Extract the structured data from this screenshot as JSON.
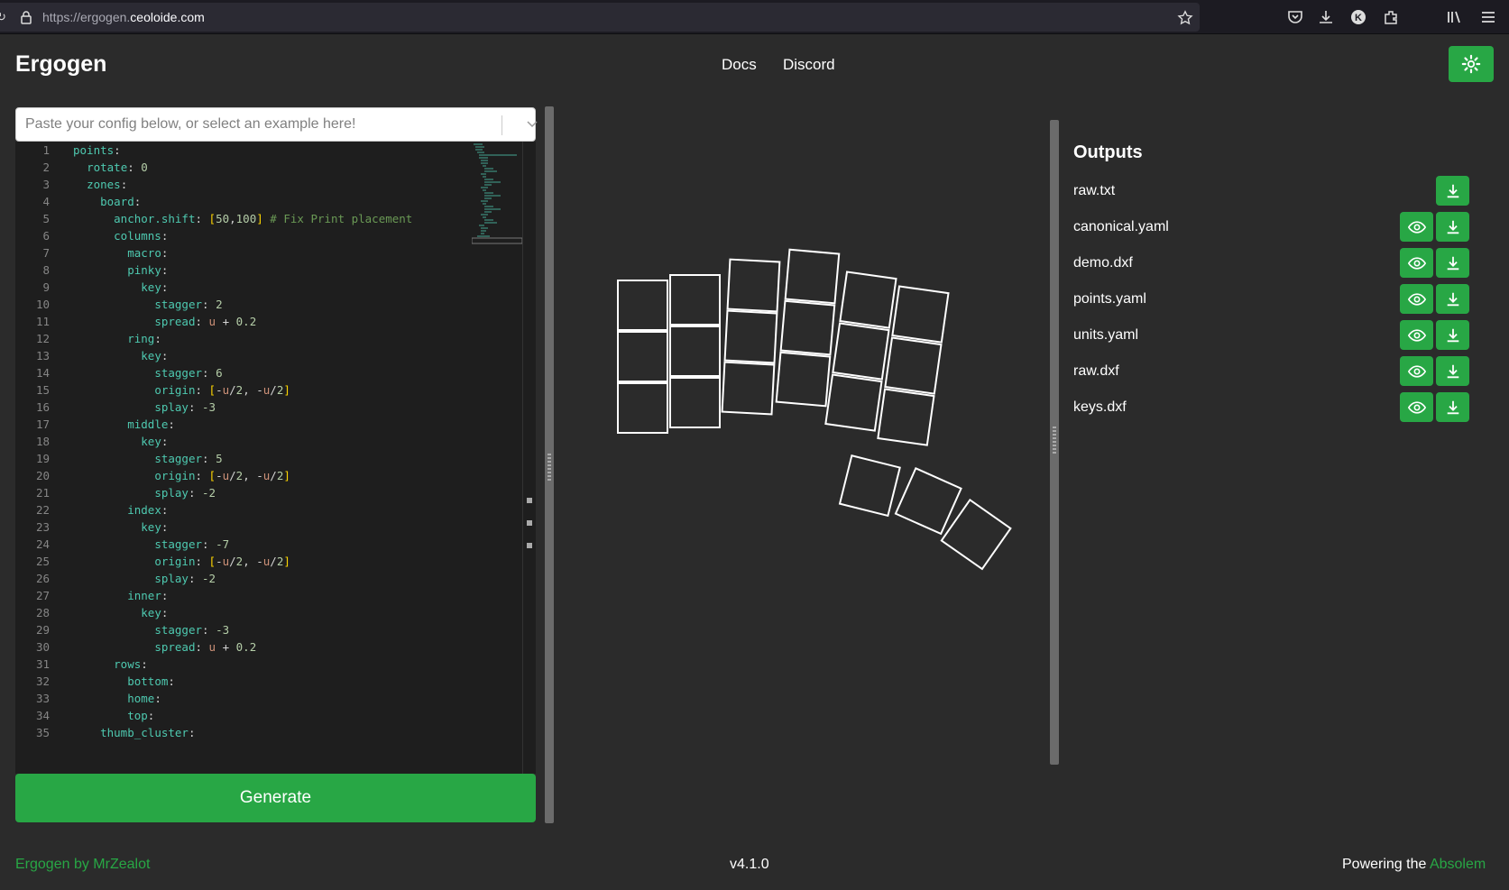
{
  "browser": {
    "url_prefix": "https://ergogen.",
    "url_domain": "ceoloide.com"
  },
  "header": {
    "brand": "Ergogen",
    "nav": [
      "Docs",
      "Discord"
    ]
  },
  "config_select": {
    "placeholder": "Paste your config below, or select an example here!"
  },
  "editor": {
    "line_numbers": [
      "1",
      "2",
      "3",
      "4",
      "5",
      "6",
      "7",
      "8",
      "9",
      "10",
      "11",
      "12",
      "13",
      "14",
      "15",
      "16",
      "17",
      "18",
      "19",
      "20",
      "21",
      "22",
      "23",
      "24",
      "25",
      "26",
      "27",
      "28",
      "29",
      "30",
      "31",
      "32",
      "33",
      "34",
      "35"
    ],
    "lines": [
      "points:",
      "  rotate: 0",
      "  zones:",
      "    board:",
      "      anchor.shift: [50,100] # Fix Print placement",
      "      columns:",
      "        macro:",
      "        pinky:",
      "          key:",
      "            stagger: 2",
      "            spread: u + 0.2",
      "        ring:",
      "          key:",
      "            stagger: 6",
      "            origin: [-u/2, -u/2]",
      "            splay: -3",
      "        middle:",
      "          key:",
      "            stagger: 5",
      "            origin: [-u/2, -u/2]",
      "            splay: -2",
      "        index:",
      "          key:",
      "            stagger: -7",
      "            origin: [-u/2, -u/2]",
      "            splay: -2",
      "        inner:",
      "          key:",
      "            stagger: -3",
      "            spread: u + 0.2",
      "      rows:",
      "        bottom:",
      "        home:",
      "        top:",
      "    thumb_cluster:"
    ]
  },
  "generate_label": "Generate",
  "outputs": {
    "title": "Outputs",
    "files": [
      {
        "name": "raw.txt",
        "preview": false
      },
      {
        "name": "canonical.yaml",
        "preview": true
      },
      {
        "name": "demo.dxf",
        "preview": true
      },
      {
        "name": "points.yaml",
        "preview": true
      },
      {
        "name": "units.yaml",
        "preview": true
      },
      {
        "name": "raw.dxf",
        "preview": true
      },
      {
        "name": "keys.dxf",
        "preview": true
      }
    ]
  },
  "footer": {
    "left_link": "Ergogen by MrZealot",
    "version": "v4.1.0",
    "right_prefix": "Powering the ",
    "right_link": "Absolem"
  },
  "colors": {
    "accent": "#28a745",
    "background": "#2b2b2b",
    "editor_bg": "#1e1e1e"
  }
}
